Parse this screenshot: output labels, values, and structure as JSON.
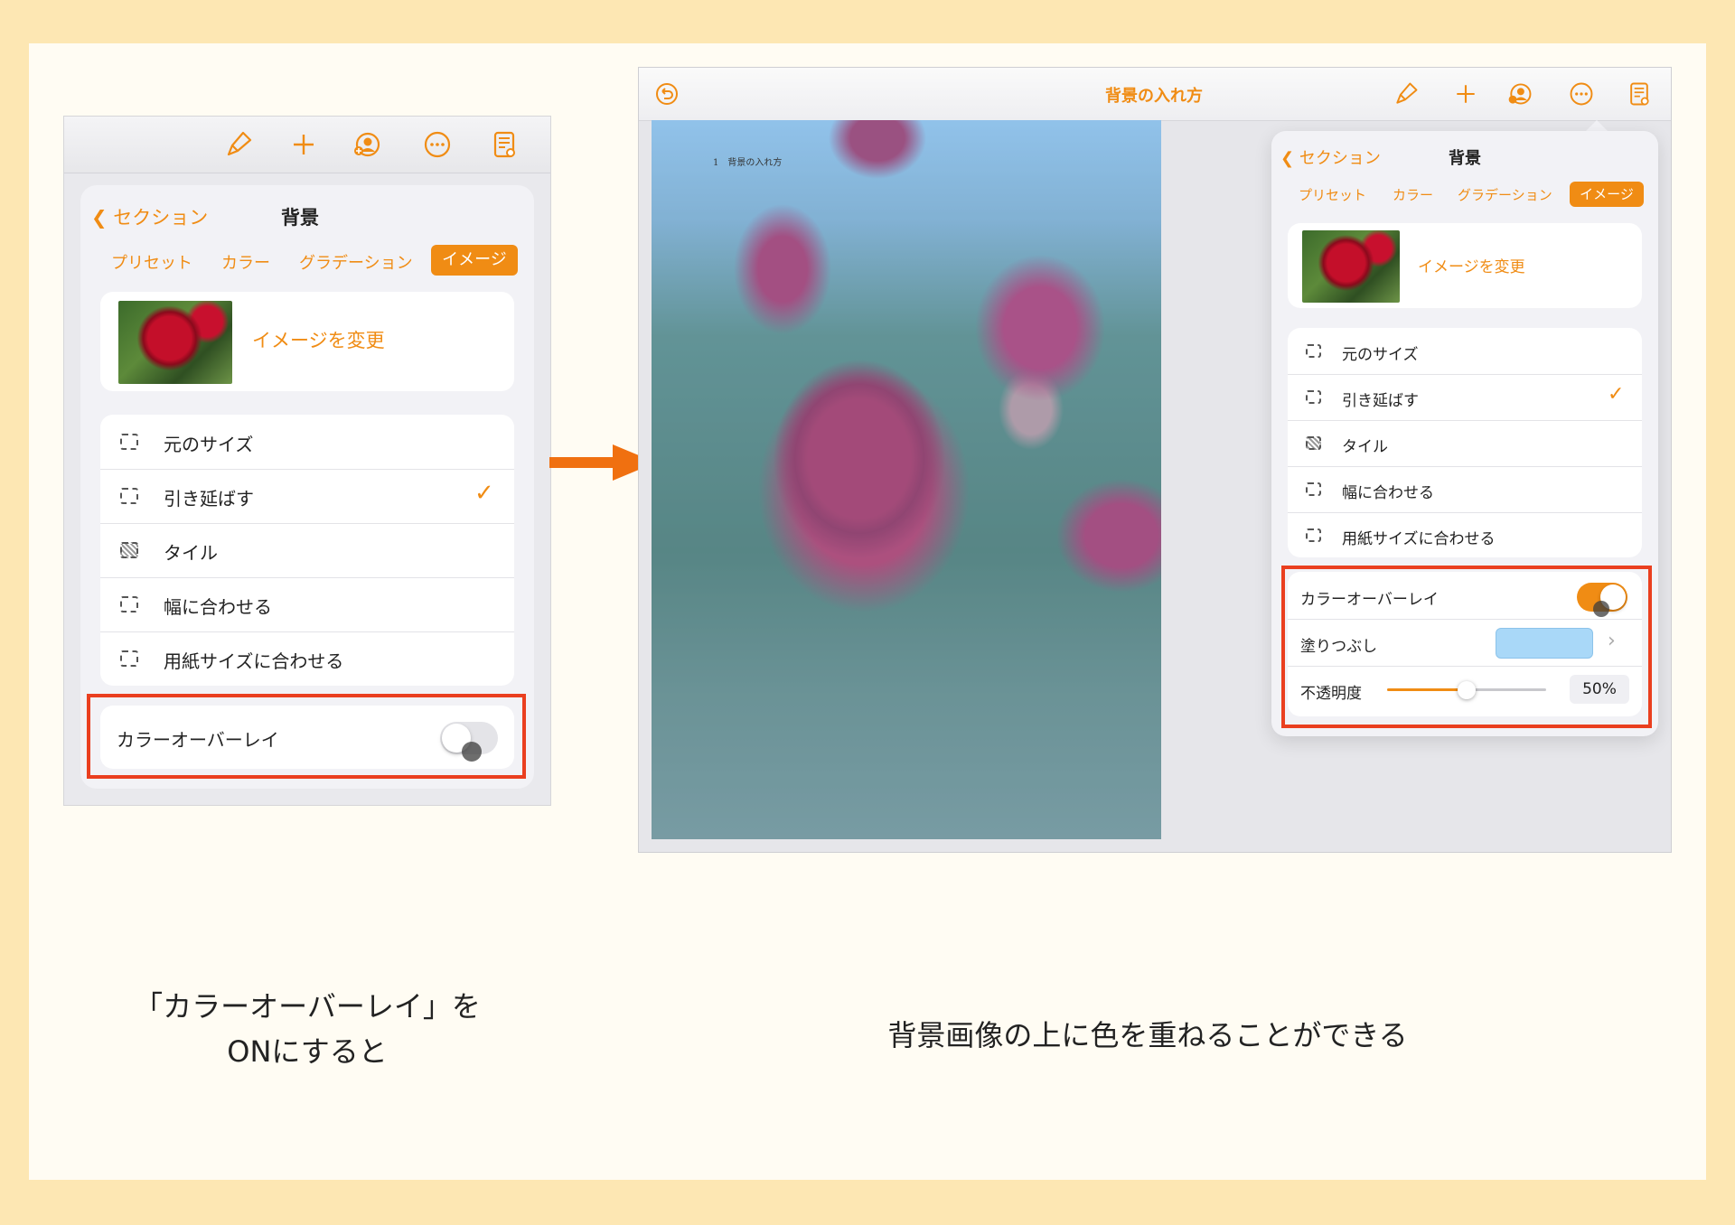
{
  "colors": {
    "accent": "#f08c14",
    "highlight": "#ea3f1f",
    "swatch": "#a9d8f8"
  },
  "toolbar_icons": [
    "paintbrush-icon",
    "plus-icon",
    "collaborate-icon",
    "more-icon",
    "document-setup-icon"
  ],
  "left": {
    "nav": {
      "back": "セクション",
      "title": "背景"
    },
    "tabs": [
      "プリセット",
      "カラー",
      "グラデーション",
      "イメージ"
    ],
    "selected_tab": "イメージ",
    "change_image": "イメージを変更",
    "options": [
      {
        "label": "元のサイズ",
        "icon": "original-size-icon"
      },
      {
        "label": "引き延ばす",
        "icon": "stretch-icon",
        "checked": true
      },
      {
        "label": "タイル",
        "icon": "tile-icon"
      },
      {
        "label": "幅に合わせる",
        "icon": "fit-width-icon"
      },
      {
        "label": "用紙サイズに合わせる",
        "icon": "fit-paper-icon"
      }
    ],
    "check_mark": "✓",
    "color_overlay": {
      "label": "カラーオーバーレイ",
      "on": false
    }
  },
  "right": {
    "document_title": "背景の入れ方",
    "page_heading": "1　背景の入れ方",
    "nav": {
      "back": "セクション",
      "title": "背景"
    },
    "tabs": [
      "プリセット",
      "カラー",
      "グラデーション",
      "イメージ"
    ],
    "selected_tab": "イメージ",
    "change_image": "イメージを変更",
    "options": [
      {
        "label": "元のサイズ",
        "icon": "original-size-icon"
      },
      {
        "label": "引き延ばす",
        "icon": "stretch-icon",
        "checked": true
      },
      {
        "label": "タイル",
        "icon": "tile-icon"
      },
      {
        "label": "幅に合わせる",
        "icon": "fit-width-icon"
      },
      {
        "label": "用紙サイズに合わせる",
        "icon": "fit-paper-icon"
      }
    ],
    "check_mark": "✓",
    "color_overlay": {
      "label": "カラーオーバーレイ",
      "on": true
    },
    "fill": {
      "label": "塗りつぶし",
      "chevron": "›"
    },
    "opacity": {
      "label": "不透明度",
      "value": 0.5,
      "value_label": "50%"
    }
  },
  "captions": {
    "left_line1": "「カラーオーバーレイ」を",
    "left_line2": "ONにすると",
    "right": "背景画像の上に色を重ねることができる"
  }
}
